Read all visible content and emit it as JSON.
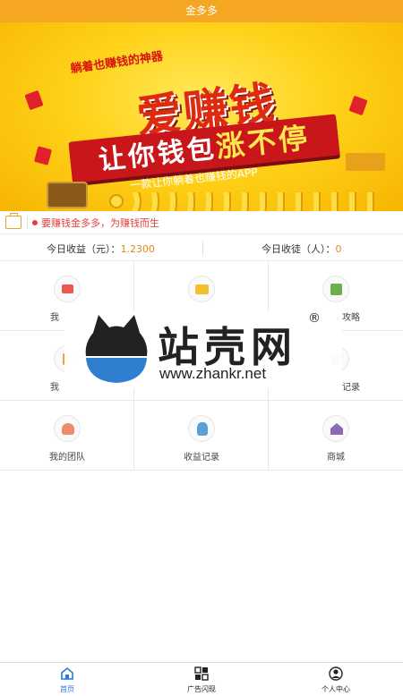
{
  "app": {
    "title": "金多多"
  },
  "banner": {
    "tagline": "躺着也赚钱的神器",
    "headline": "爱赚钱",
    "ribbon_main": "让你钱包",
    "ribbon_highlight": "涨不停",
    "subtitle": "一款让你躺着也赚钱的APP"
  },
  "notice": {
    "text": "要赚钱金多多，为赚钱而生"
  },
  "stats": {
    "income_label": "今日收益（元）：",
    "income_value": "1.2300",
    "recruit_label": "今日收徒（人）：",
    "recruit_value": "0"
  },
  "grid": {
    "items": [
      {
        "label": "我",
        "icon": "gift-icon"
      },
      {
        "label": "",
        "icon": "wallet-icon"
      },
      {
        "label": "攻略",
        "icon": "guide-icon"
      },
      {
        "label": "我",
        "icon": "orange-icon"
      },
      {
        "label": "",
        "icon": "blank-icon"
      },
      {
        "label": "记录",
        "icon": "record-icon"
      },
      {
        "label": "我的团队",
        "icon": "team-icon"
      },
      {
        "label": "收益记录",
        "icon": "money-bag-icon"
      },
      {
        "label": "商城",
        "icon": "shop-icon"
      }
    ]
  },
  "watermark": {
    "title": "站壳网",
    "reg": "®",
    "url": "www.zhankr.net"
  },
  "tabbar": {
    "items": [
      {
        "label": "首页",
        "icon": "home-icon",
        "active": true
      },
      {
        "label": "广告闪现",
        "icon": "grid-icon",
        "active": false
      },
      {
        "label": "个人中心",
        "icon": "user-icon",
        "active": false
      }
    ]
  },
  "colors": {
    "header": "#f5a623",
    "accent_red": "#e53e3e",
    "accent_orange": "#e08a1e",
    "tab_active": "#2a7ad6"
  }
}
